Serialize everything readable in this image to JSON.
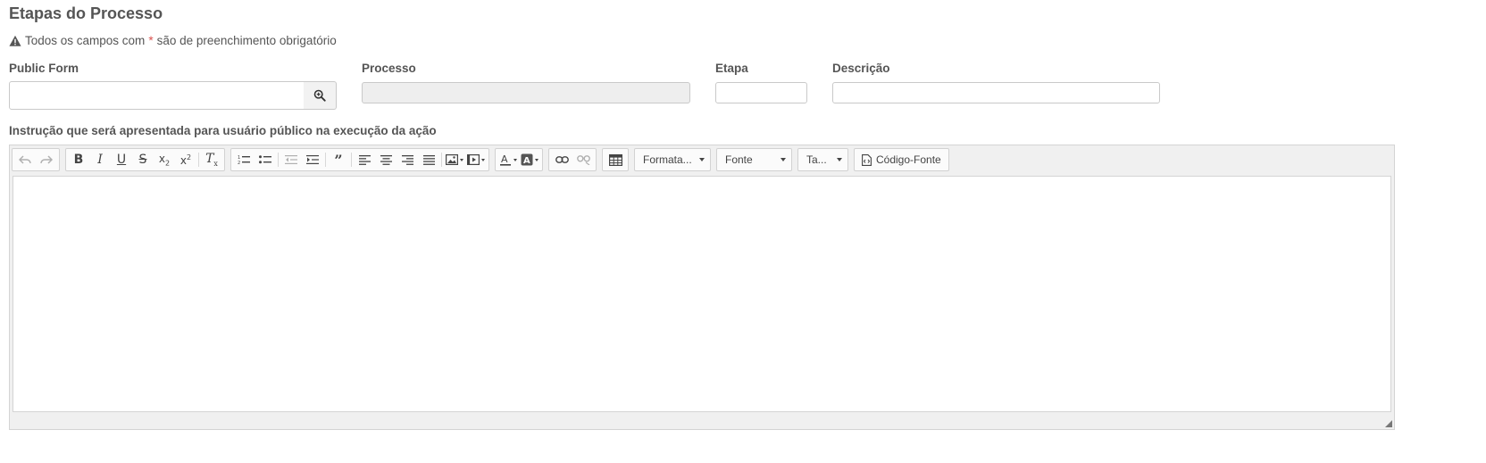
{
  "page": {
    "title": "Etapas do Processo",
    "required_note_prefix": "Todos os campos com",
    "required_note_star": "*",
    "required_note_suffix": "são de preenchimento obrigatório"
  },
  "form": {
    "public_form": {
      "label": "Public Form",
      "value": ""
    },
    "processo": {
      "label": "Processo",
      "value": ""
    },
    "etapa": {
      "label": "Etapa",
      "value": ""
    },
    "descricao": {
      "label": "Descrição",
      "value": ""
    }
  },
  "editor": {
    "label": "Instrução que será apresentada para usuário público na execução da ação",
    "format_combo": "Formata...",
    "font_combo": "Fonte",
    "size_combo": "Ta...",
    "source_button": "Código-Fonte",
    "content": ""
  },
  "colors": {
    "required_star": "#d9534f",
    "readonly_bg": "#eeeeee",
    "toolbar_bg": "#f0f0f0"
  }
}
